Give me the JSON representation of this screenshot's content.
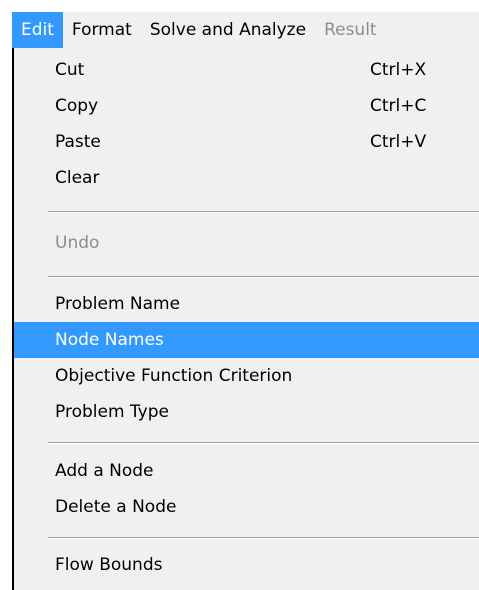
{
  "menubar": {
    "items": [
      {
        "label": "Edit"
      },
      {
        "label": "Format"
      },
      {
        "label": "Solve and Analyze"
      },
      {
        "label": "Result"
      }
    ]
  },
  "edit_menu": {
    "items": [
      {
        "label": "Cut",
        "shortcut": "Ctrl+X"
      },
      {
        "label": "Copy",
        "shortcut": "Ctrl+C"
      },
      {
        "label": "Paste",
        "shortcut": "Ctrl+V"
      },
      {
        "label": "Clear"
      },
      {
        "label": "Undo"
      },
      {
        "label": "Problem Name"
      },
      {
        "label": "Node Names"
      },
      {
        "label": "Objective Function Criterion"
      },
      {
        "label": "Problem Type"
      },
      {
        "label": "Add a Node"
      },
      {
        "label": "Delete a Node"
      },
      {
        "label": "Flow Bounds"
      }
    ]
  },
  "colors": {
    "highlight": "#3399ff",
    "menu_bg": "#f0f0f0",
    "disabled_text": "#8d8d8d"
  }
}
